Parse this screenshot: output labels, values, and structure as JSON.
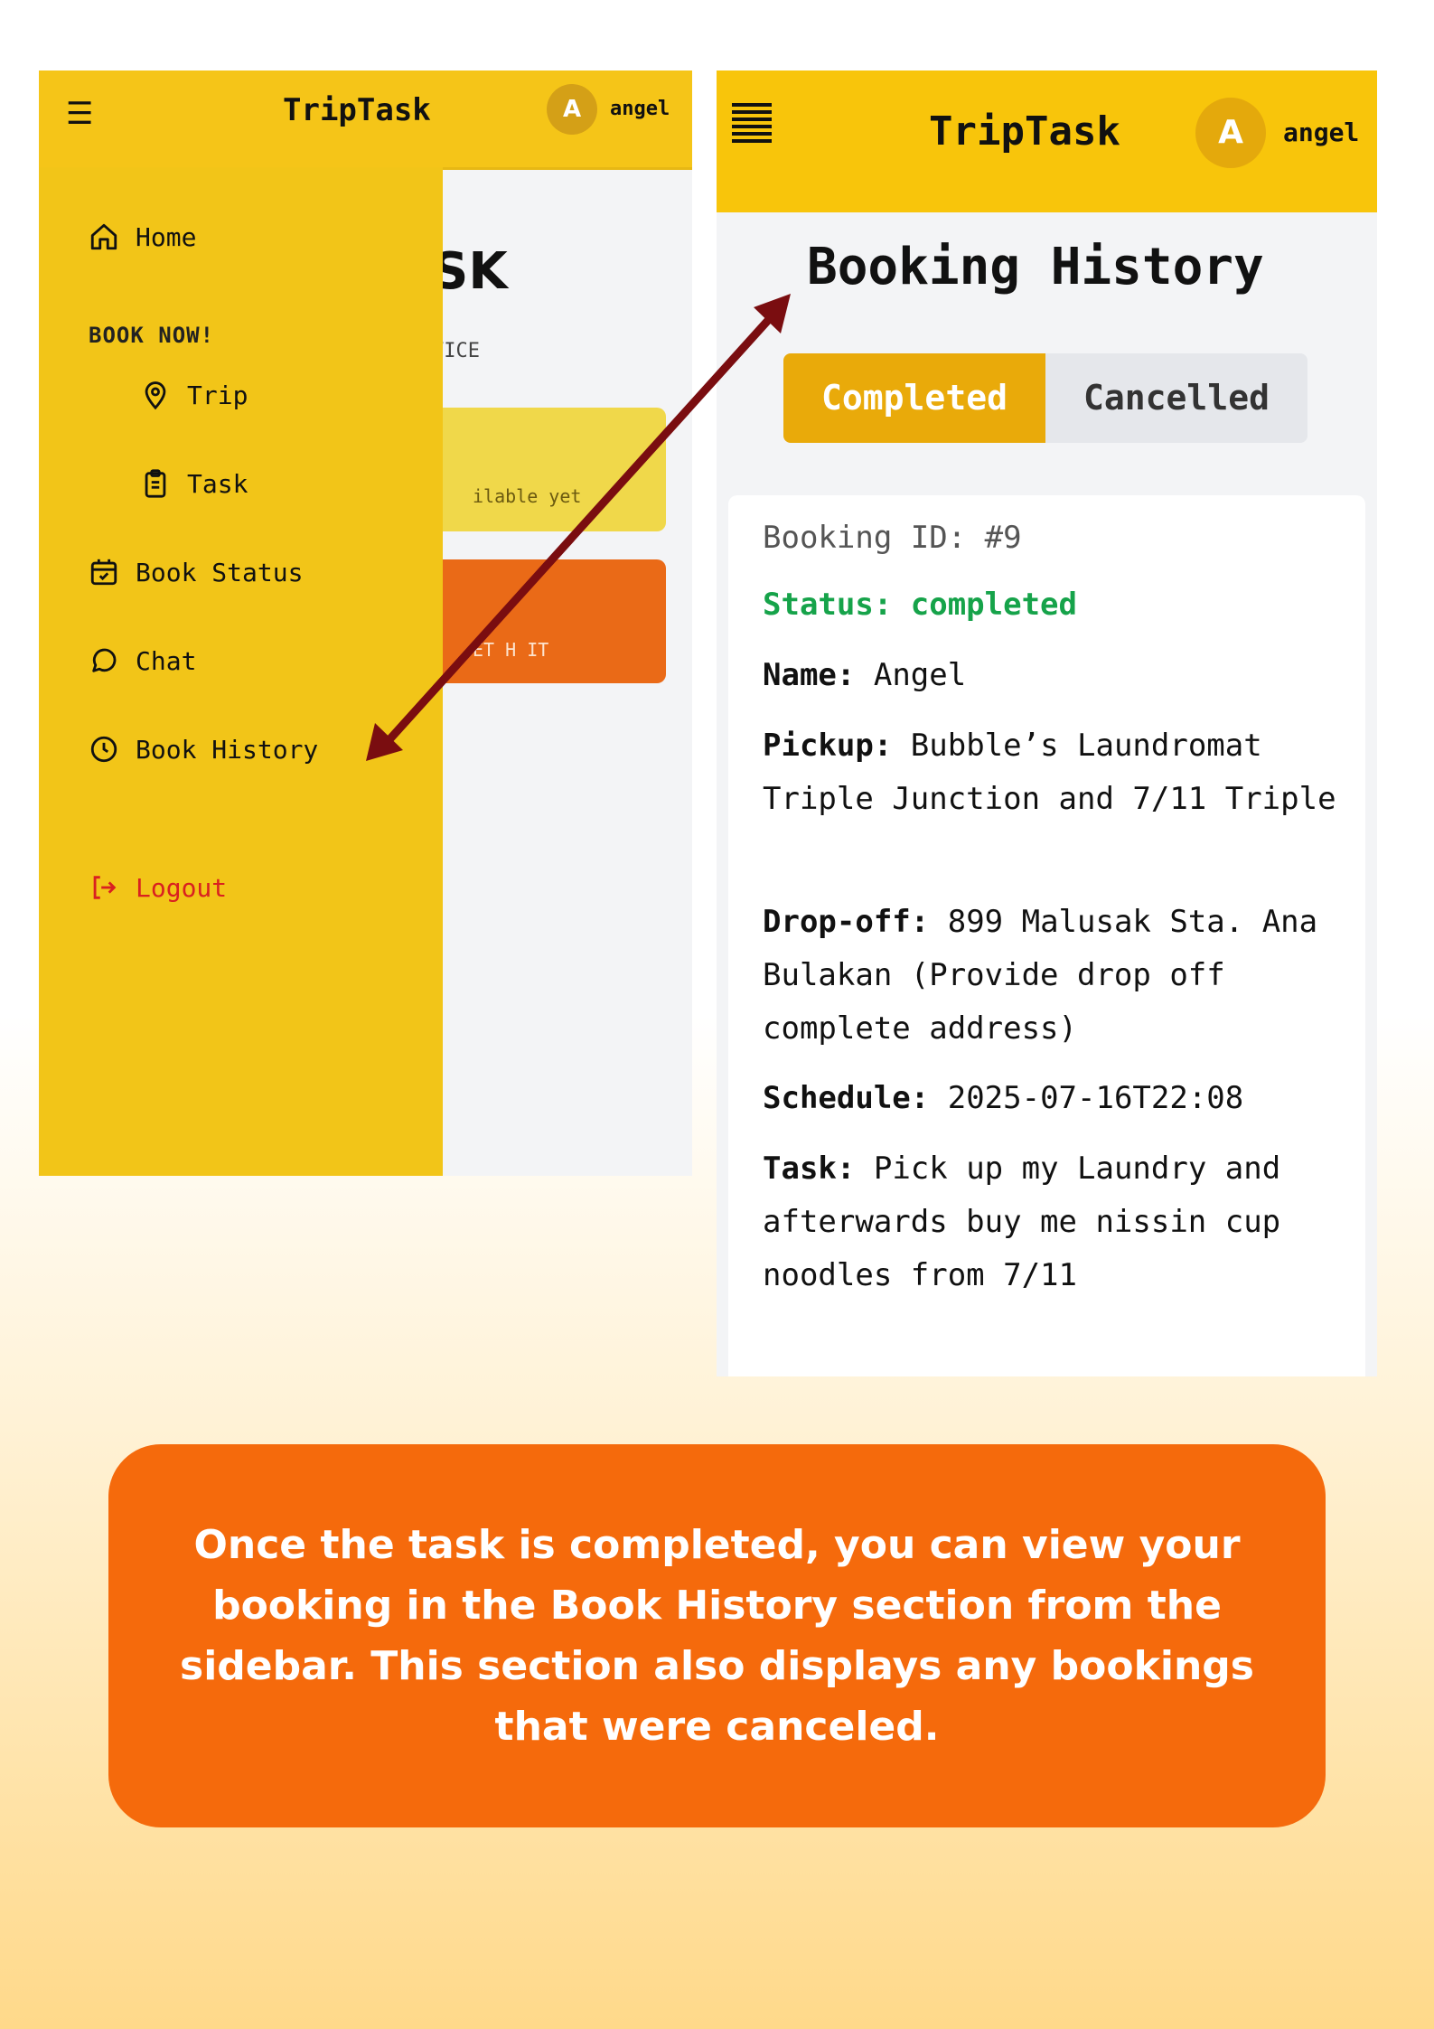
{
  "left_screen": {
    "header": {
      "title": "TripTask",
      "avatar_initial": "A",
      "username": "angel",
      "menu_icon": "hamburger-icon"
    },
    "background": {
      "heading_fragment": "SK",
      "sub_fragment": "VICE",
      "yellow_card_text": "ilable yet",
      "orange_card_text": "ET H IT"
    },
    "sidebar": {
      "home": "Home",
      "section_label": "BOOK NOW!",
      "trip": "Trip",
      "task": "Task",
      "book_status": "Book Status",
      "chat": "Chat",
      "book_history": "Book History",
      "logout": "Logout"
    }
  },
  "right_screen": {
    "header": {
      "title": "TripTask",
      "avatar_initial": "A",
      "username": "angel"
    },
    "page_title": "Booking History",
    "tabs": {
      "completed": "Completed",
      "cancelled": "Cancelled",
      "active": "Completed"
    },
    "booking": {
      "id_line": "Booking ID: #9",
      "status_line": "Status: completed",
      "name_label": "Name:",
      "name_value": "Angel",
      "pickup_label": "Pickup:",
      "pickup_value": "Bubble’s Laundromat Triple Junction and 7/11 Triple",
      "dropoff_label": "Drop-off:",
      "dropoff_value": "899 Malusak Sta. Ana Bulakan (Provide drop off complete address)",
      "schedule_label": "Schedule:",
      "schedule_value": "2025-07-16T22:08",
      "task_label": "Task:",
      "task_value": "Pick up my Laundry and afterwards buy me nissin cup noodles from 7/11"
    }
  },
  "caption": {
    "text": "Once the task is completed, you can view your booking in the Book History section from the sidebar. This section also displays any bookings that were canceled."
  },
  "colors": {
    "brand_yellow": "#f5c518",
    "accent_orange": "#f56a0c",
    "arrow": "#7a0d10",
    "status_green": "#16a34a",
    "logout_red": "#d92020"
  }
}
